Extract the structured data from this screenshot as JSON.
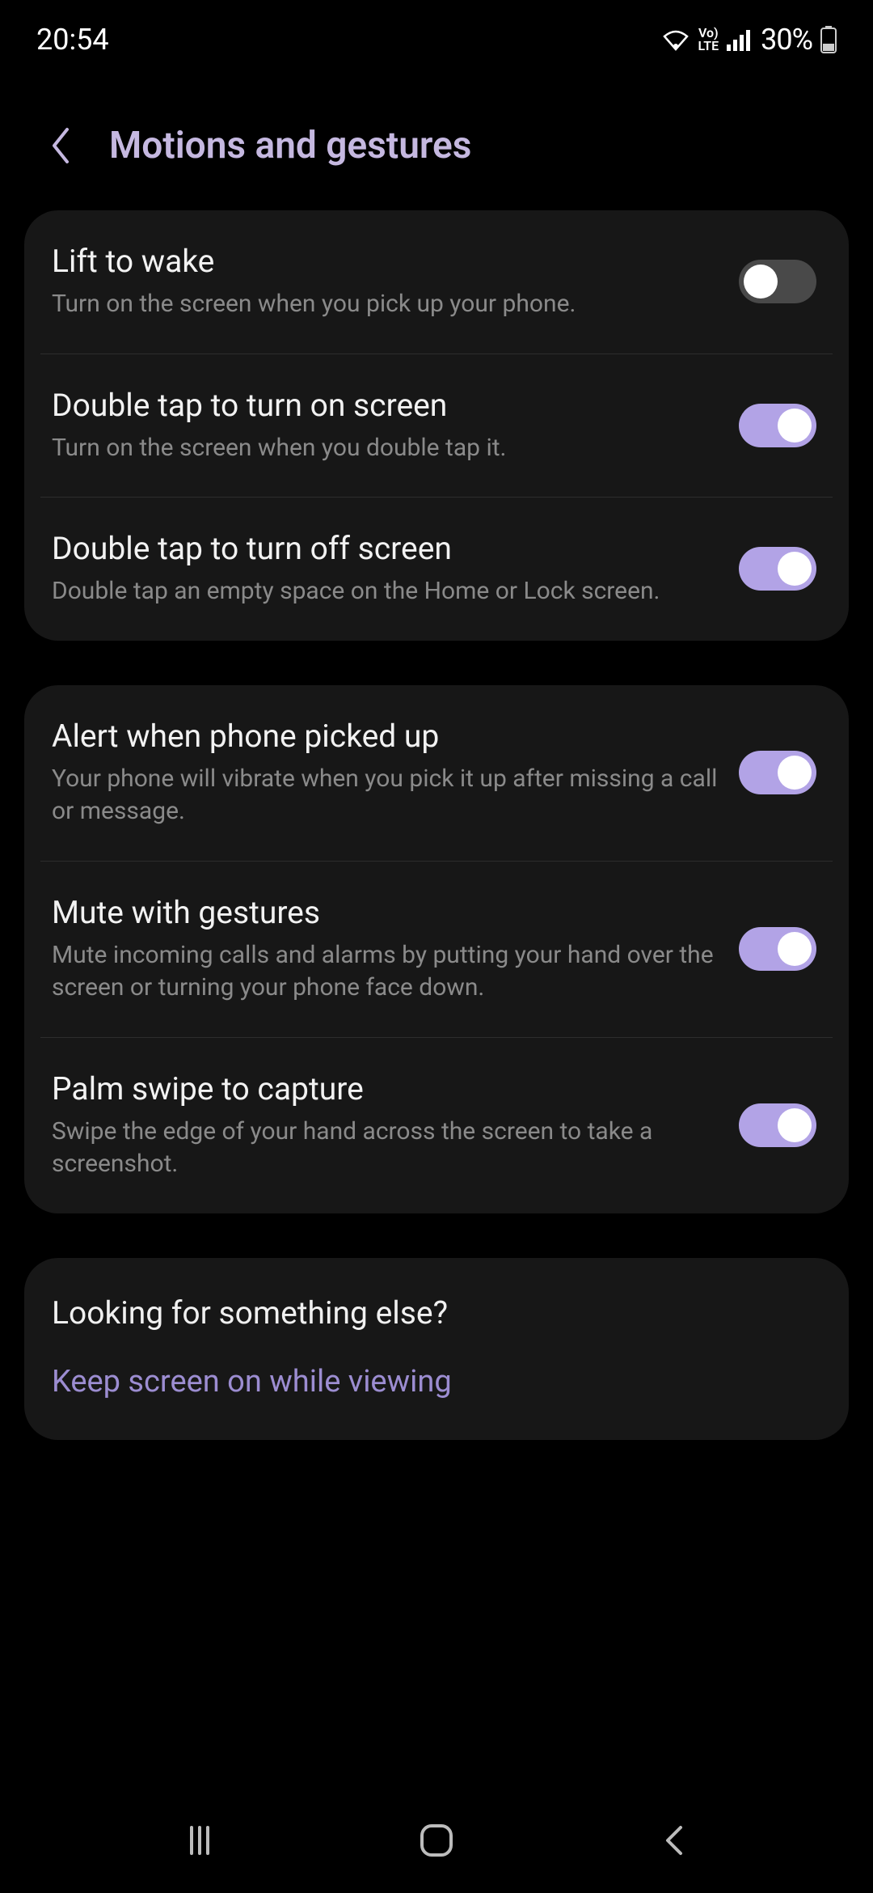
{
  "status": {
    "time": "20:54",
    "battery_text": "30%"
  },
  "header": {
    "title": "Motions and gestures"
  },
  "groups": [
    {
      "items": [
        {
          "title": "Lift to wake",
          "desc": "Turn on the screen when you pick up your phone.",
          "on": false
        },
        {
          "title": "Double tap to turn on screen",
          "desc": "Turn on the screen when you double tap it.",
          "on": true
        },
        {
          "title": "Double tap to turn off screen",
          "desc": "Double tap an empty space on the Home or Lock screen.",
          "on": true
        }
      ]
    },
    {
      "items": [
        {
          "title": "Alert when phone picked up",
          "desc": "Your phone will vibrate when you pick it up after missing a call or message.",
          "on": true
        },
        {
          "title": "Mute with gestures",
          "desc": "Mute incoming calls and alarms by putting your hand over the screen or turning your phone face down.",
          "on": true
        },
        {
          "title": "Palm swipe to capture",
          "desc": "Swipe the edge of your hand across the screen to take a screenshot.",
          "on": true
        }
      ]
    }
  ],
  "footer": {
    "title": "Looking for something else?",
    "link": "Keep screen on while viewing"
  }
}
